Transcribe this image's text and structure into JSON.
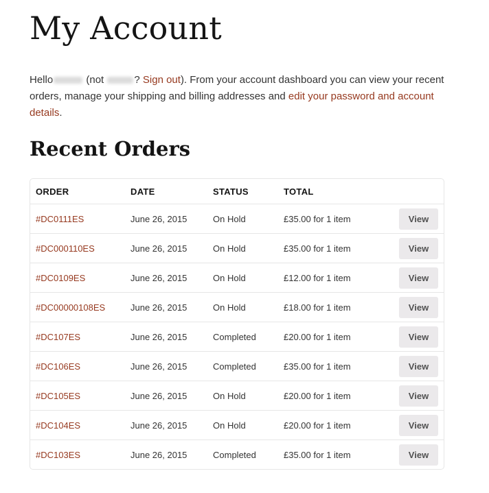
{
  "page": {
    "title": "My Account"
  },
  "intro": {
    "hello": "Hello",
    "not_prefix": " (not ",
    "not_suffix": "? ",
    "sign_out": "Sign out",
    "middle_text": "). From your account dashboard you can view your recent orders, manage your shipping and billing addresses and ",
    "edit_link": "edit your password and account details",
    "end": "."
  },
  "recent_orders": {
    "title": "Recent Orders",
    "headers": {
      "order": "ORDER",
      "date": "DATE",
      "status": "STATUS",
      "total": "TOTAL"
    },
    "view_label": "View",
    "rows": [
      {
        "order": "#DC0111ES",
        "date": "June 26, 2015",
        "status": "On Hold",
        "total": "£35.00 for 1 item"
      },
      {
        "order": "#DC000110ES",
        "date": "June 26, 2015",
        "status": "On Hold",
        "total": "£35.00 for 1 item"
      },
      {
        "order": "#DC0109ES",
        "date": "June 26, 2015",
        "status": "On Hold",
        "total": "£12.00 for 1 item"
      },
      {
        "order": "#DC00000108ES",
        "date": "June 26, 2015",
        "status": "On Hold",
        "total": "£18.00 for 1 item"
      },
      {
        "order": "#DC107ES",
        "date": "June 26, 2015",
        "status": "Completed",
        "total": "£20.00 for 1 item"
      },
      {
        "order": "#DC106ES",
        "date": "June 26, 2015",
        "status": "Completed",
        "total": "£35.00 for 1 item"
      },
      {
        "order": "#DC105ES",
        "date": "June 26, 2015",
        "status": "On Hold",
        "total": "£20.00 for 1 item"
      },
      {
        "order": "#DC104ES",
        "date": "June 26, 2015",
        "status": "On Hold",
        "total": "£20.00 for 1 item"
      },
      {
        "order": "#DC103ES",
        "date": "June 26, 2015",
        "status": "Completed",
        "total": "£35.00 for 1 item"
      }
    ]
  },
  "colors": {
    "link": "#96391f",
    "heading": "#141414",
    "text": "#333333",
    "button_bg": "#ebe9eb",
    "border": "#e6e6e6"
  }
}
